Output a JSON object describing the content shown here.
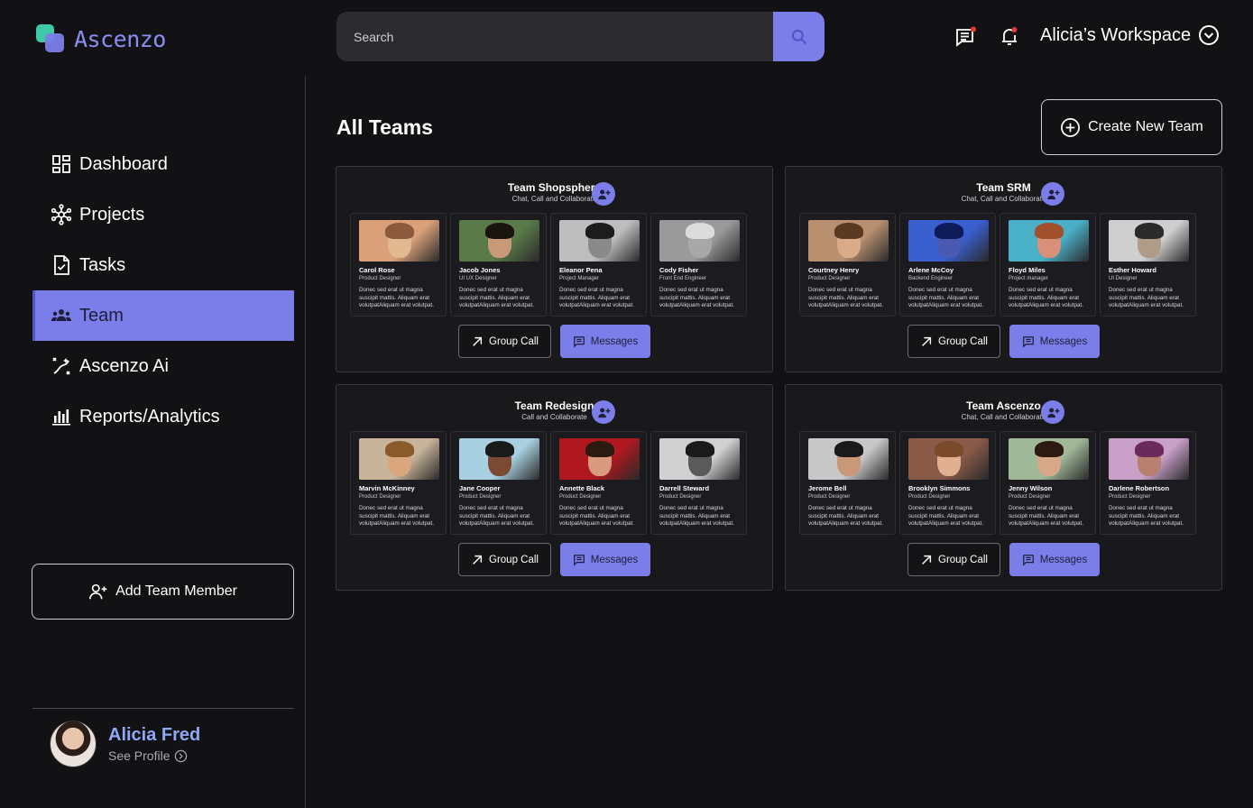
{
  "app": {
    "logo_text": "Ascenzo"
  },
  "colors": {
    "accent": "#7b7ee8",
    "background": "#121214",
    "card": "#19191c",
    "profile_name": "#8fa8f5",
    "logo_green": "#3ec9a7"
  },
  "search": {
    "placeholder": "Search"
  },
  "header": {
    "workspace_label": "Alicia’s Workspace"
  },
  "sidebar": {
    "items": [
      {
        "label": "Dashboard",
        "icon": "dashboard-icon",
        "active": false
      },
      {
        "label": "Projects",
        "icon": "projects-icon",
        "active": false
      },
      {
        "label": "Tasks",
        "icon": "tasks-icon",
        "active": false
      },
      {
        "label": "Team",
        "icon": "team-icon",
        "active": true
      },
      {
        "label": "Ascenzo Ai",
        "icon": "ai-icon",
        "active": false
      },
      {
        "label": "Reports/Analytics",
        "icon": "analytics-icon",
        "active": false
      }
    ],
    "add_member_label": "Add Team Member"
  },
  "profile": {
    "name": "Alicia Fred",
    "link_label": "See Profile"
  },
  "main": {
    "title": "All Teams",
    "create_label": "Create New Team",
    "teams": [
      {
        "name": "Team Shopsphere",
        "subtitle": "Chat, Call and Collaborate",
        "call_label": "Group Call",
        "messages_label": "Messages",
        "members": [
          {
            "name": "Carol Rose",
            "role": "Product Designer",
            "desc": "Donec sed erat ut magna suscipit mattis. Aliquam erat volutpatAliquam erat volutpat."
          },
          {
            "name": "Jacob Jones",
            "role": "UI UX Designer",
            "desc": "Donec sed erat ut magna suscipit mattis. Aliquam erat volutpatAliquam erat volutpat."
          },
          {
            "name": "Eleanor Pena",
            "role": "Project Manager",
            "desc": "Donec sed erat ut magna suscipit mattis. Aliquam erat volutpatAliquam erat volutpat."
          },
          {
            "name": "Cody Fisher",
            "role": "Front End Engineer",
            "desc": "Donec sed erat ut magna suscipit mattis. Aliquam erat volutpatAliquam erat volutpat."
          }
        ]
      },
      {
        "name": "Team SRM",
        "subtitle": "Chat, Call and Collaborate",
        "call_label": "Group Call",
        "messages_label": "Messages",
        "members": [
          {
            "name": "Courtney Henry",
            "role": "Product Designer",
            "desc": "Donec sed erat ut magna suscipit mattis. Aliquam erat volutpatAliquam erat volutpat."
          },
          {
            "name": "Arlene McCoy",
            "role": "Backend Engineer",
            "desc": "Donec sed erat ut magna suscipit mattis. Aliquam erat volutpatAliquam erat volutpat."
          },
          {
            "name": "Floyd Miles",
            "role": "Project manager",
            "desc": "Donec sed erat ut magna suscipit mattis. Aliquam erat volutpatAliquam erat volutpat."
          },
          {
            "name": "Esther Howard",
            "role": "UI Designer",
            "desc": "Donec sed erat ut magna suscipit mattis. Aliquam erat volutpatAliquam erat volutpat."
          }
        ]
      },
      {
        "name": "Team Redesign",
        "subtitle": "Call and Collaborate",
        "call_label": "Group Call",
        "messages_label": "Messages",
        "members": [
          {
            "name": "Marvin McKinney",
            "role": "Product Designer",
            "desc": "Donec sed erat ut magna suscipit mattis. Aliquam erat volutpatAliquam erat volutpat."
          },
          {
            "name": "Jane Cooper",
            "role": "Product Designer",
            "desc": "Donec sed erat ut magna suscipit mattis. Aliquam erat volutpatAliquam erat volutpat."
          },
          {
            "name": "Annette Black",
            "role": "Product Designer",
            "desc": "Donec sed erat ut magna suscipit mattis. Aliquam erat volutpatAliquam erat volutpat."
          },
          {
            "name": "Darrell Steward",
            "role": "Product Designer",
            "desc": "Donec sed erat ut magna suscipit mattis. Aliquam erat volutpatAliquam erat volutpat."
          }
        ]
      },
      {
        "name": "Team Ascenzo",
        "subtitle": "Chat, Call and Collaborate",
        "call_label": "Group Call",
        "messages_label": "Messages",
        "members": [
          {
            "name": "Jerome Bell",
            "role": "Product Designer",
            "desc": "Donec sed erat ut magna suscipit mattis. Aliquam erat volutpatAliquam erat volutpat."
          },
          {
            "name": "Brooklyn Simmons",
            "role": "Product Designer",
            "desc": "Donec sed erat ut magna suscipit mattis. Aliquam erat volutpatAliquam erat volutpat."
          },
          {
            "name": "Jenny Wilson",
            "role": "Product Designer",
            "desc": "Donec sed erat ut magna suscipit mattis. Aliquam erat volutpatAliquam erat volutpat."
          },
          {
            "name": "Darlene Robertson",
            "role": "Product Designer",
            "desc": "Donec sed erat ut magna suscipit mattis. Aliquam erat volutpatAliquam erat volutpat."
          }
        ]
      }
    ]
  }
}
